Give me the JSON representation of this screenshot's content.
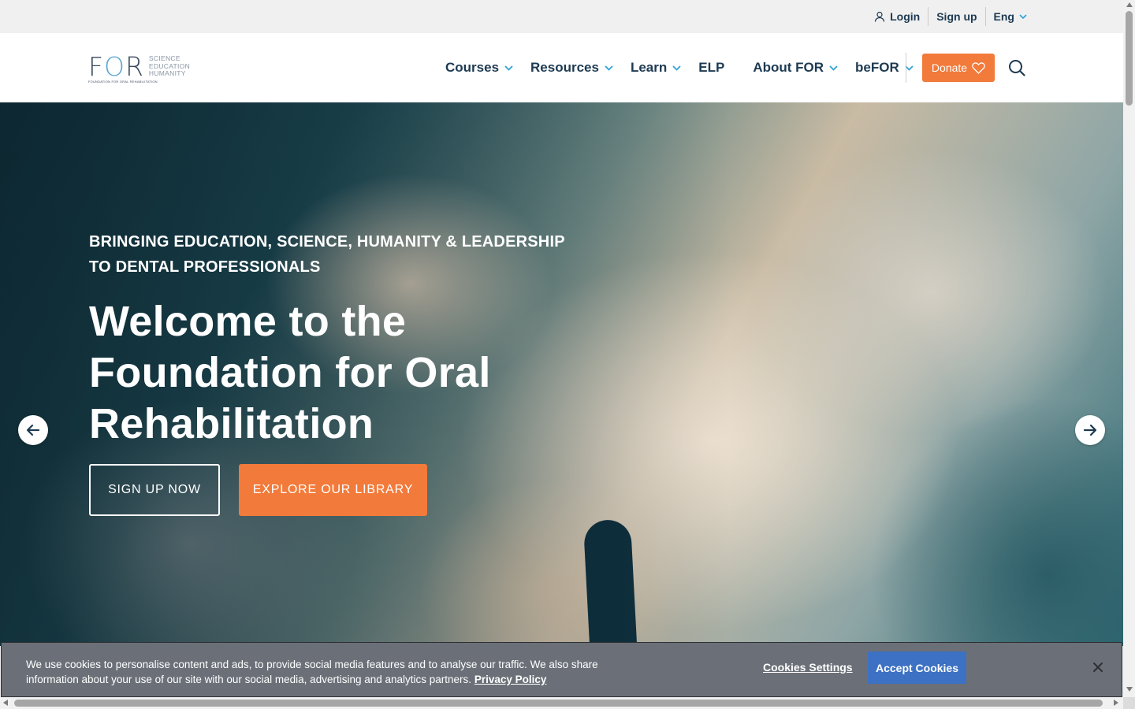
{
  "topbar": {
    "login": "Login",
    "signup": "Sign up",
    "language": "Eng"
  },
  "logo": {
    "mark_f": "F",
    "mark_o": "O",
    "mark_r": "R",
    "tag_line1": "SCIENCE",
    "tag_line2": "EDUCATION",
    "tag_line3": "HUMANITY",
    "sub": "FOUNDATION FOR ORAL REHABILITATION"
  },
  "nav": {
    "items": [
      {
        "label": "Courses"
      },
      {
        "label": "Resources"
      },
      {
        "label": "Learn"
      },
      {
        "label": "ELP"
      },
      {
        "label": "About FOR"
      },
      {
        "label": "beFOR"
      }
    ],
    "donate": "Donate"
  },
  "hero": {
    "eyebrow_line1": "BRINGING EDUCATION, SCIENCE, HUMANITY & LEADERSHIP",
    "eyebrow_line2": "TO DENTAL PROFESSIONALS",
    "title_line1": "Welcome to the",
    "title_line2": "Foundation for Oral",
    "title_line3": "Rehabilitation",
    "cta_primary": "SIGN UP NOW",
    "cta_secondary": "EXPLORE OUR LIBRARY"
  },
  "cookie": {
    "text": "We use cookies to personalise content and ads, to provide social media features and to analyse our traffic. We also share information about your use of our site with our social media, advertising and analytics partners.",
    "policy_link": "Privacy Policy",
    "settings": "Cookies Settings",
    "accept": "Accept Cookies"
  },
  "colors": {
    "accent_orange": "#f27a3a",
    "nav_text": "#1d3a52",
    "chevron_blue": "#2ea3d6",
    "cookie_accept": "#3c71c3"
  }
}
